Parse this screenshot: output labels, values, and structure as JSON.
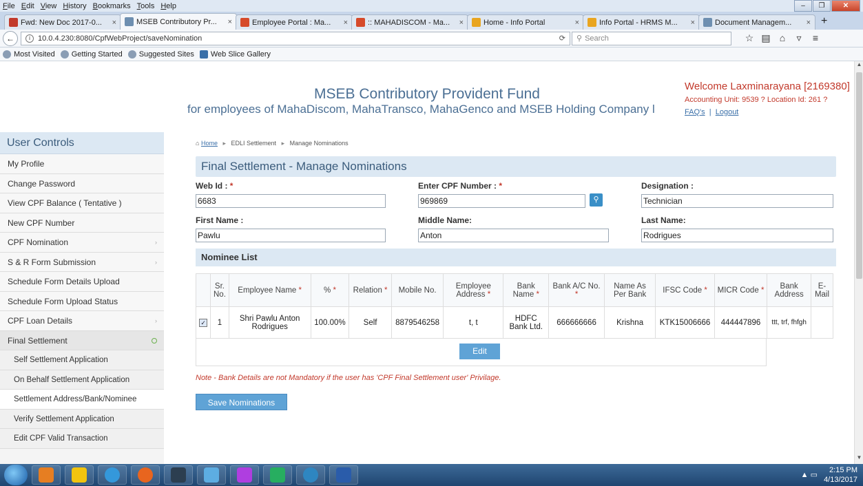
{
  "browser": {
    "menu": [
      "File",
      "Edit",
      "View",
      "History",
      "Bookmarks",
      "Tools",
      "Help"
    ],
    "tabs": [
      {
        "title": "Fwd: New Doc 2017-0...",
        "color": "#c23a2b",
        "active": false
      },
      {
        "title": "MSEB Contributory Pr...",
        "color": "#6e8fb0",
        "active": true
      },
      {
        "title": "Employee Portal : Ma...",
        "color": "#d64a2a",
        "active": false
      },
      {
        "title": ":: MAHADISCOM - Ma...",
        "color": "#d64a2a",
        "active": false
      },
      {
        "title": "Home - Info Portal",
        "color": "#e9a520",
        "active": false
      },
      {
        "title": "Info Portal - HRMS M...",
        "color": "#e9a520",
        "active": false
      },
      {
        "title": "Document Managem...",
        "color": "#6e8fb0",
        "active": false
      }
    ],
    "url": "10.0.4.230:8080/CpfWebProject/saveNomination",
    "search_placeholder": "Search",
    "bookmarks": [
      "Most Visited",
      "Getting Started",
      "Suggested Sites",
      "Web Slice Gallery"
    ]
  },
  "header": {
    "title": "MSEB Contributory Provident Fund",
    "subtitle": "for employees of MahaDiscom, MahaTransco, MahaGenco and MSEB Holding Company l",
    "welcome": "Welcome Laxminarayana [2169380]",
    "account_info": "Accounting Unit: 9539 ?   Location Id: 261 ?",
    "faq": "FAQ's",
    "logout": "Logout"
  },
  "sidebar": {
    "title": "User Controls",
    "items": [
      {
        "label": "My Profile"
      },
      {
        "label": "Change Password"
      },
      {
        "label": "View CPF Balance ( Tentative )"
      },
      {
        "label": "New CPF Number"
      },
      {
        "label": "CPF Nomination"
      },
      {
        "label": "S & R Form Submission"
      },
      {
        "label": "Schedule Form Details Upload"
      },
      {
        "label": "Schedule Form Upload Status"
      },
      {
        "label": "CPF Loan Details"
      },
      {
        "label": "Final Settlement"
      }
    ],
    "subitems": [
      {
        "label": "Self Settlement Application"
      },
      {
        "label": "On Behalf Settlement Application"
      },
      {
        "label": "Settlement Address/Bank/Nominee"
      },
      {
        "label": "Verify Settlement Application"
      },
      {
        "label": "Edit CPF Valid Transaction"
      }
    ]
  },
  "breadcrumb": {
    "home": "Home",
    "level1": "EDLI Settlement",
    "level2": "Manage Nominations"
  },
  "form": {
    "title": "Final Settlement - Manage Nominations",
    "web_id_label": "Web Id :",
    "web_id": "6683",
    "cpf_label": "Enter CPF Number :",
    "cpf_number": "969869",
    "designation_label": "Designation :",
    "designation": "Technician",
    "first_name_label": "First Name :",
    "first_name": "Pawlu",
    "middle_name_label": "Middle Name:",
    "middle_name": "Anton",
    "last_name_label": "Last Name:",
    "last_name": "Rodrigues"
  },
  "nominees": {
    "title": "Nominee List",
    "headers": {
      "sr": "Sr. No.",
      "name": "Employee Name",
      "pct": "%",
      "relation": "Relation",
      "mobile": "Mobile No.",
      "address": "Employee Address",
      "bank": "Bank Name",
      "account": "Bank A/C No.",
      "name_as_bank": "Name As Per Bank",
      "ifsc": "IFSC Code",
      "micr": "MICR Code",
      "bank_address": "Bank Address",
      "email": "E-Mail"
    },
    "rows": [
      {
        "sr": "1",
        "name": "Shri Pawlu Anton Rodrigues",
        "pct": "100.00%",
        "relation": "Self",
        "mobile": "8879546258",
        "address": "t, t",
        "bank": "HDFC Bank Ltd.",
        "account": "666666666",
        "name_as_bank": "Krishna",
        "ifsc": "KTK15006666",
        "micr": "444447896",
        "bank_address": "ttt, trf, fhfgh",
        "email": ""
      }
    ],
    "edit_label": "Edit"
  },
  "note": "Note - Bank Details are not Mandatory if the user has 'CPF Final Settlement user' Privilage.",
  "save_label": "Save Nominations",
  "taskbar": {
    "time": "2:15 PM",
    "date": "4/13/2017"
  }
}
